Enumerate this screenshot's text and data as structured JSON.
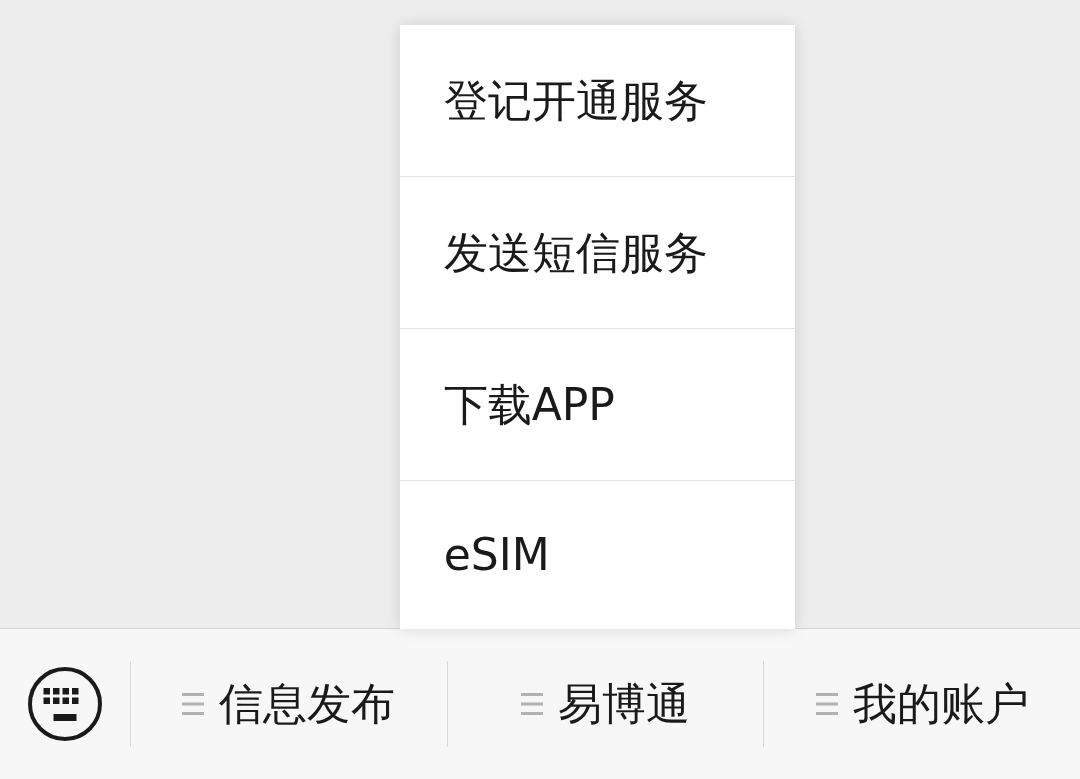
{
  "menu_bar": {
    "items": [
      {
        "label": "信息发布"
      },
      {
        "label": "易博通",
        "submenu": [
          "登记开通服务",
          "发送短信服务",
          "下载APP",
          "eSIM"
        ]
      },
      {
        "label": "我的账户"
      }
    ]
  }
}
